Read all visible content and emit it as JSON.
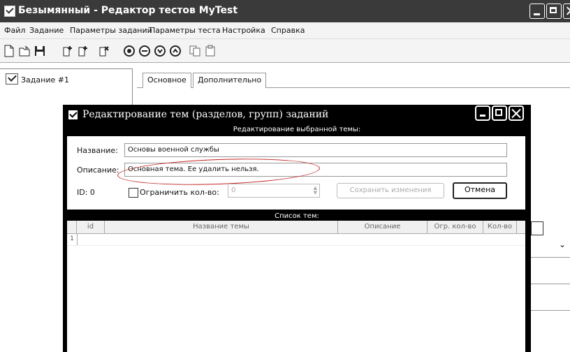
{
  "window": {
    "title": "Безымянный - Редактор тестов MyTest"
  },
  "menu": [
    "Файл",
    "Задание",
    "Параметры заданий",
    "Параметры теста",
    "Настройка",
    "Справка"
  ],
  "tree": {
    "node_label": "Задание #1"
  },
  "tabs": [
    "Основное",
    "Дополнительно"
  ],
  "dialog": {
    "title": "Редактирование тем (разделов, групп) заданий",
    "subtitle": "Редактирование выбранной темы:",
    "name_label": "Название:",
    "name_value": "Основы военной службы",
    "desc_label": "Описание:",
    "desc_value": "Основная тема. Ее удалить нельзя.",
    "id_label": "ID: 0",
    "limit_label": "Ограничить кол-во:",
    "limit_checked": false,
    "limit_value": "0",
    "save_button": "Сохранить изменения",
    "cancel_button": "Отмена",
    "list_header": "Список тем:",
    "columns": [
      "id",
      "Название темы",
      "Описание",
      "Огр. кол-во",
      "Кол-во"
    ],
    "rows": [
      {
        "num": "1"
      }
    ]
  },
  "colors": {
    "titlebar": "#3a3a3a",
    "dialog_frame": "#000000",
    "highlight_ellipse": "#c02020"
  },
  "icons": [
    "new-file-icon",
    "open-folder-icon",
    "save-icon",
    "add-task-icon",
    "insert-task-icon",
    "delete-task-icon",
    "theme-icon-1",
    "theme-icon-2",
    "theme-icon-3",
    "theme-icon-4",
    "copy-icon",
    "paste-icon"
  ]
}
